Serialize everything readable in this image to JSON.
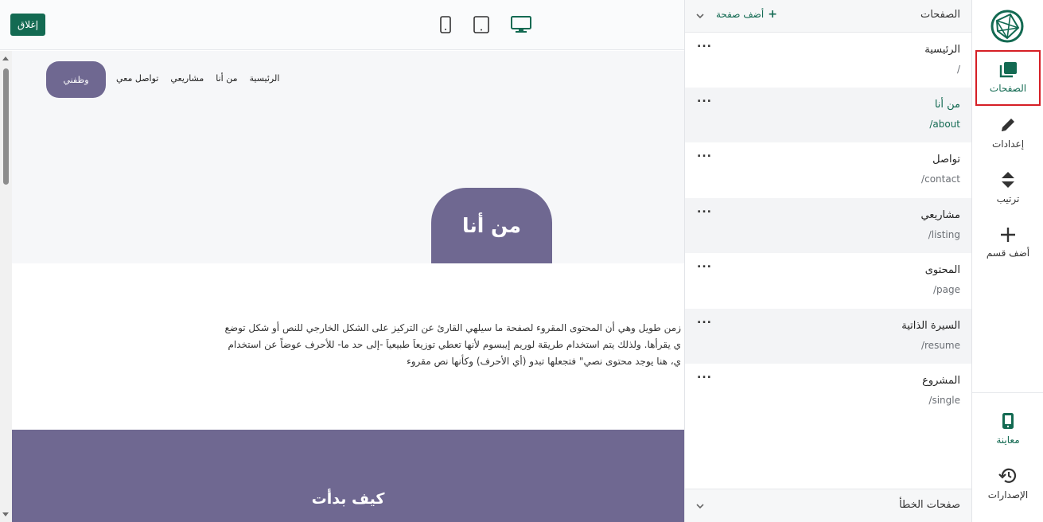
{
  "toolbar": {
    "close_label": "إغلاق",
    "devices": [
      "phone-icon",
      "tablet-icon",
      "desktop-icon"
    ],
    "active_device": "desktop"
  },
  "site": {
    "nav": [
      "الرئيسية",
      "من أنا",
      "مشاريعي",
      "تواصل معي"
    ],
    "hire_label": "وظفني",
    "page_title": "من أنا",
    "body_lines": [
      "زمن طويل وهي أن المحتوى المقروء لصفحة ما سيلهي القارئ عن التركيز على الشكل الخارجي للنص أو شكل توضع",
      "ي يقرأها. ولذلك يتم استخدام طريقة لوريم إيبسوم لأنها تعطي توزيعاَ طبيعياَ -إلى حد ما- للأحرف عوضاً عن استخدام",
      "ي، هنا يوجد محتوى نصي\" فتجعلها تبدو (أي الأحرف) وكأنها نص مقروء"
    ],
    "section_title": "كيف بدأت"
  },
  "pages_panel": {
    "title": "الصفحات",
    "add_label": "أضف صفحة",
    "pages": [
      {
        "name": "الرئيسية",
        "slug": "/"
      },
      {
        "name": "من أنا",
        "slug": "/about"
      },
      {
        "name": "تواصل",
        "slug": "/contact"
      },
      {
        "name": "مشاريعي",
        "slug": "/listing"
      },
      {
        "name": "المحتوى",
        "slug": "/page"
      },
      {
        "name": "السيرة الذاتية",
        "slug": "/resume"
      },
      {
        "name": "المشروع",
        "slug": "/single"
      }
    ],
    "active_page": "/about",
    "more_label": "...",
    "errors_title": "صفحات الخطأ"
  },
  "rail": {
    "items": [
      {
        "label": "الصفحات",
        "icon": "pages-icon"
      },
      {
        "label": "إعدادات",
        "icon": "pencil-icon"
      },
      {
        "label": "ترتيب",
        "icon": "sort-icon"
      },
      {
        "label": "أضف قسم",
        "icon": "plus-icon"
      }
    ],
    "bottom_items": [
      {
        "label": "معاينة",
        "icon": "mobile-preview-icon"
      },
      {
        "label": "الإصدارات",
        "icon": "history-icon"
      }
    ]
  },
  "colors": {
    "brand_green": "#136a52",
    "site_purple": "#6f6891",
    "highlight_red": "#d61f26"
  }
}
